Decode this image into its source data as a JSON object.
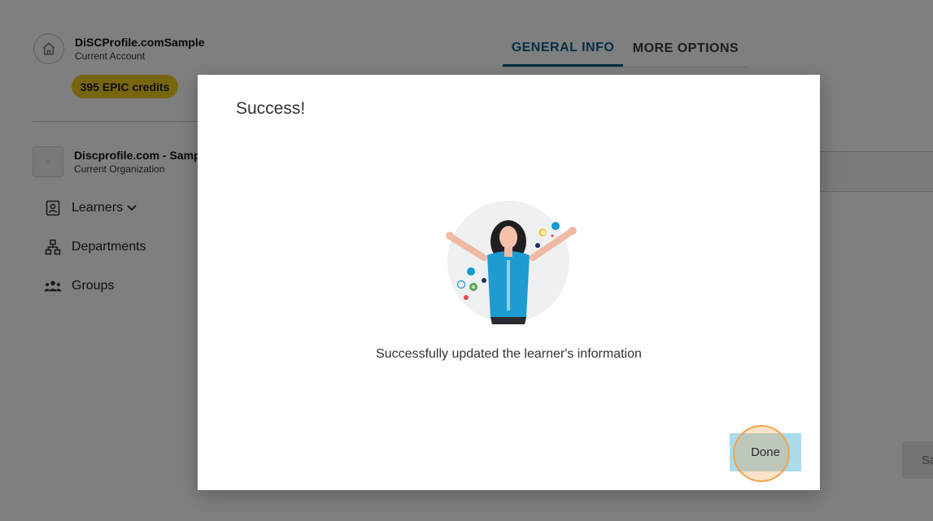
{
  "account": {
    "name": "DiSCProfile.comSample",
    "subtitle": "Current Account",
    "credits": "395 EPIC credits"
  },
  "organization": {
    "name": "Discprofile.com - Samp",
    "subtitle": "Current Organization"
  },
  "nav": {
    "items": [
      {
        "label": "Learners",
        "icon": "id-badge-icon"
      },
      {
        "label": "Departments",
        "icon": "org-chart-icon"
      },
      {
        "label": "Groups",
        "icon": "group-icon"
      }
    ]
  },
  "tabs": [
    {
      "label": "GENERAL INFO",
      "active": true
    },
    {
      "label": "MORE OPTIONS",
      "active": false
    }
  ],
  "background": {
    "save_partial": "Sa"
  },
  "modal": {
    "title": "Success!",
    "message": "Successfully updated the learner's information",
    "done_label": "Done"
  },
  "colors": {
    "tab_active": "#0e5a8a",
    "credits_badge": "#f1cc1f",
    "done_button": "#a9dcec",
    "highlight": "#f4a24b"
  }
}
